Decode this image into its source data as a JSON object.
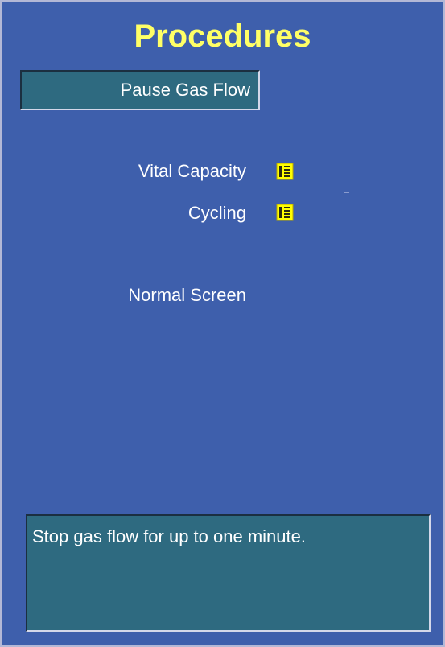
{
  "header": {
    "title": "Procedures"
  },
  "actions": {
    "pause_gas_flow_label": "Pause Gas Flow"
  },
  "menu": {
    "items": [
      {
        "label": "Vital Capacity",
        "icon": "document-icon"
      },
      {
        "label": "Cycling",
        "icon": "document-icon"
      },
      {
        "label": "Normal Screen"
      }
    ]
  },
  "description": {
    "text": "Stop gas flow for up to one minute."
  },
  "colors": {
    "panel_background": "#3e5fac",
    "title": "#ffff66",
    "field_background": "#2e6a80",
    "icon": "#ffff00",
    "text": "#ffffff"
  }
}
